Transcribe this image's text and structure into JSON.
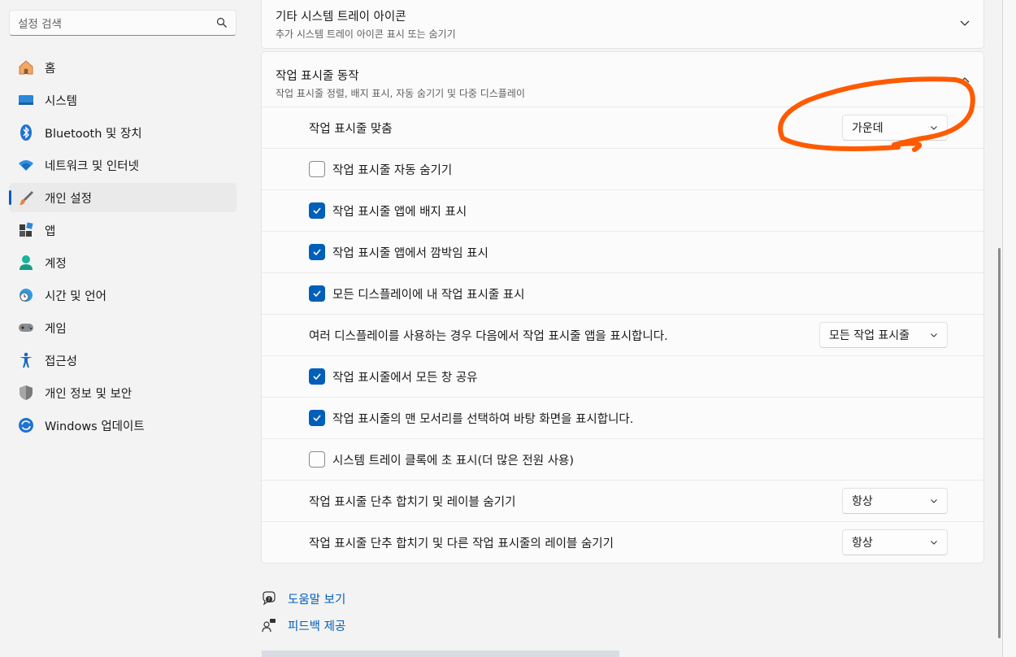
{
  "search": {
    "placeholder": "설정 검색"
  },
  "sidebar": {
    "items": [
      {
        "label": "홈",
        "icon": "home-icon"
      },
      {
        "label": "시스템",
        "icon": "system-icon"
      },
      {
        "label": "Bluetooth 및 장치",
        "icon": "bluetooth-icon"
      },
      {
        "label": "네트워크 및 인터넷",
        "icon": "wifi-icon"
      },
      {
        "label": "개인 설정",
        "icon": "brush-icon",
        "active": true
      },
      {
        "label": "앱",
        "icon": "apps-icon"
      },
      {
        "label": "계정",
        "icon": "account-icon"
      },
      {
        "label": "시간 및 언어",
        "icon": "globe-clock-icon"
      },
      {
        "label": "게임",
        "icon": "gamepad-icon"
      },
      {
        "label": "접근성",
        "icon": "accessibility-icon"
      },
      {
        "label": "개인 정보 및 보안",
        "icon": "shield-icon"
      },
      {
        "label": "Windows 업데이트",
        "icon": "update-icon"
      }
    ]
  },
  "tray_card": {
    "title": "기타 시스템 트레이 아이콘",
    "subtitle": "추가 시스템 트레이 아이콘 표시 또는 숨기기"
  },
  "behaviors": {
    "title": "작업 표시줄 동작",
    "subtitle": "작업 표시줄 정렬, 배지 표시, 자동 숨기기 및 다중 디스플레이",
    "alignment_label": "작업 표시줄 맞춤",
    "alignment_value": "가운데",
    "autohide_label": "작업 표시줄 자동 숨기기",
    "badges_label": "작업 표시줄 앱에 배지 표시",
    "flashing_label": "작업 표시줄 앱에서 깜박임 표시",
    "all_displays_label": "모든 디스플레이에 내 작업 표시줄 표시",
    "multi_display_label": "여러 디스플레이를 사용하는 경우 다음에서 작업 표시줄 앱을 표시합니다.",
    "multi_display_value": "모든 작업 표시줄",
    "share_label": "작업 표시줄에서 모든 창 공유",
    "corner_label": "작업 표시줄의 맨 모서리를 선택하여 바탕 화면을 표시합니다.",
    "seconds_label": "시스템 트레이 클록에 초 표시(더 많은 전원 사용)",
    "combine_label": "작업 표시줄 단추 합치기 및 레이블 숨기기",
    "combine_value": "항상",
    "combine_other_label": "작업 표시줄 단추 합치기 및 다른 작업 표시줄의 레이블 숨기기",
    "combine_other_value": "항상",
    "checks": {
      "autohide": false,
      "badges": true,
      "flashing": true,
      "all_displays": true,
      "share": true,
      "corner": true,
      "seconds": false
    }
  },
  "links": {
    "help": "도움말 보기",
    "feedback": "피드백 제공"
  },
  "colors": {
    "accent": "#005fb8",
    "annotation": "#ff5a00"
  }
}
